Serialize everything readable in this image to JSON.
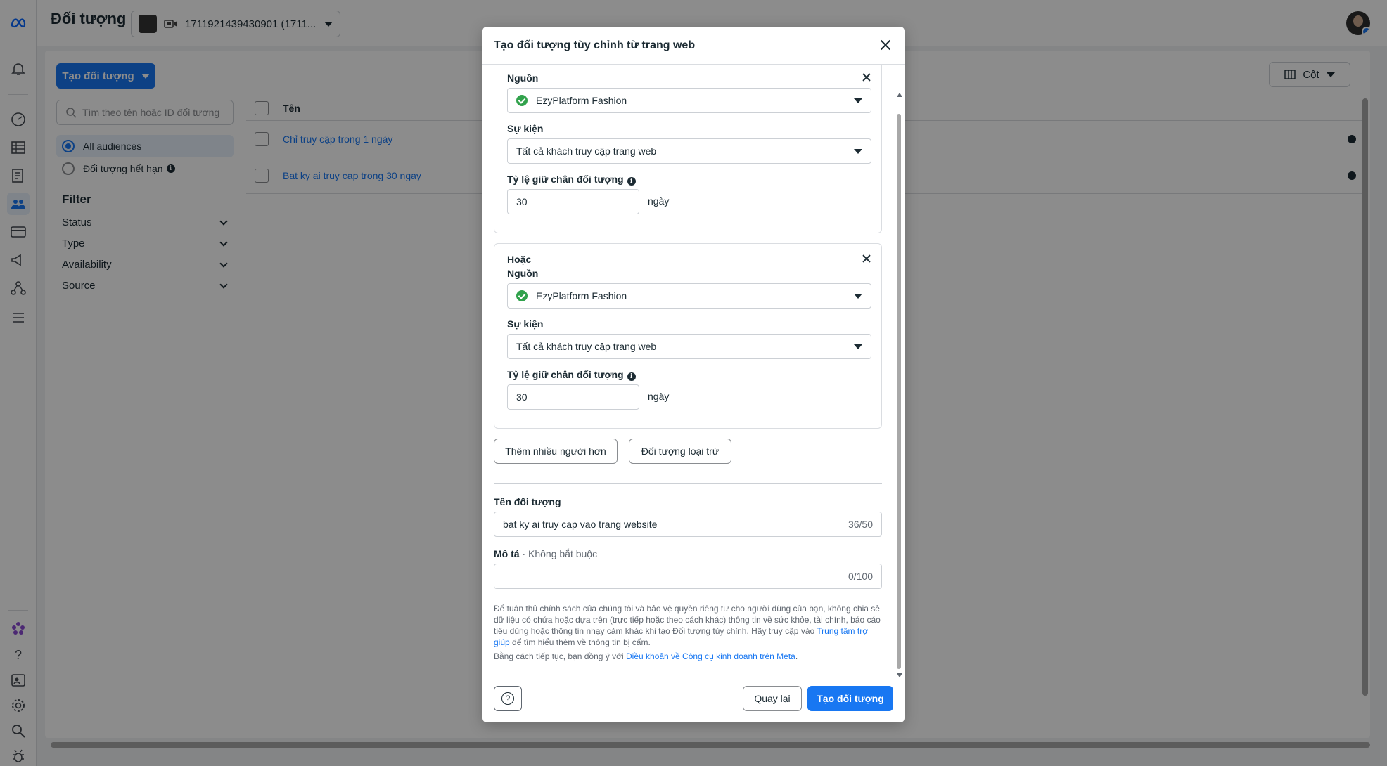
{
  "header": {
    "title": "Đối tượng",
    "account_label": "1711921439430901 (1711..."
  },
  "rail": {
    "icons": [
      "meta-logo-icon",
      "bell-icon",
      "gauge-icon",
      "table-icon",
      "document-icon",
      "people-icon",
      "card-icon",
      "megaphone-icon",
      "network-icon",
      "menu-icon",
      "flower-icon",
      "help-icon",
      "contact-icon",
      "settings-icon",
      "search-icon",
      "bug-icon"
    ]
  },
  "background": {
    "create_button": "Tạo đối tượng",
    "search_placeholder": "Tìm theo tên hoặc ID đối tượng",
    "options": [
      {
        "label": "All audiences",
        "selected": true
      },
      {
        "label": "Đối tượng hết hạn",
        "selected": false
      }
    ],
    "filter_heading": "Filter",
    "filters": [
      "Status",
      "Type",
      "Availability",
      "Source"
    ],
    "columns_button": "Cột",
    "table_header": "Tên",
    "rows": [
      "Chỉ truy cập trong 1 ngày",
      "Bat ky ai truy cap trong 30 ngay"
    ]
  },
  "modal": {
    "title": "Tạo đối tượng tùy chỉnh từ trang web",
    "rule1": {
      "source_label": "Nguồn",
      "source_value": "EzyPlatform Fashion",
      "event_label": "Sự kiện",
      "event_value": "Tất cả khách truy cập trang web",
      "retention_label": "Tỷ lệ giữ chân đối tượng",
      "retention_value": "30",
      "retention_unit": "ngày"
    },
    "rule2": {
      "or_label": "Hoặc",
      "source_label": "Nguồn",
      "source_value": "EzyPlatform Fashion",
      "event_label": "Sự kiện",
      "event_value": "Tất cả khách truy cập trang web",
      "retention_label": "Tỷ lệ giữ chân đối tượng",
      "retention_value": "30",
      "retention_unit": "ngày"
    },
    "include_more_button": "Thêm nhiều người hơn",
    "exclude_button": "Đối tượng loại trừ",
    "name_label": "Tên đối tượng",
    "name_value": "bat ky ai truy cap vao trang website",
    "name_count": "36/50",
    "desc_label": "Mô tả",
    "desc_optional": "· Không bắt buộc",
    "desc_count": "0/100",
    "policy_text": "Để tuân thủ chính sách của chúng tôi và bảo vệ quyền riêng tư cho người dùng của bạn, không chia sẻ dữ liệu có chứa hoặc dựa trên (trực tiếp hoặc theo cách khác) thông tin về sức khỏe, tài chính, báo cáo tiêu dùng hoặc thông tin nhạy cảm khác khi tạo Đối tượng tùy chỉnh. Hãy truy cập vào",
    "policy_link": "Trung tâm trợ giúp",
    "policy_tail": "để tìm hiểu thêm về thông tin bị cấm.",
    "terms_text": "Bằng cách tiếp tục, bạn đồng ý với",
    "terms_link": "Điều khoản về Công cụ kinh doanh trên Meta",
    "terms_end": ".",
    "back_button": "Quay lại",
    "create_button": "Tạo đối tượng"
  },
  "colors": {
    "primary": "#1877f2",
    "success": "#31a24c",
    "text": "#1c2b33"
  }
}
